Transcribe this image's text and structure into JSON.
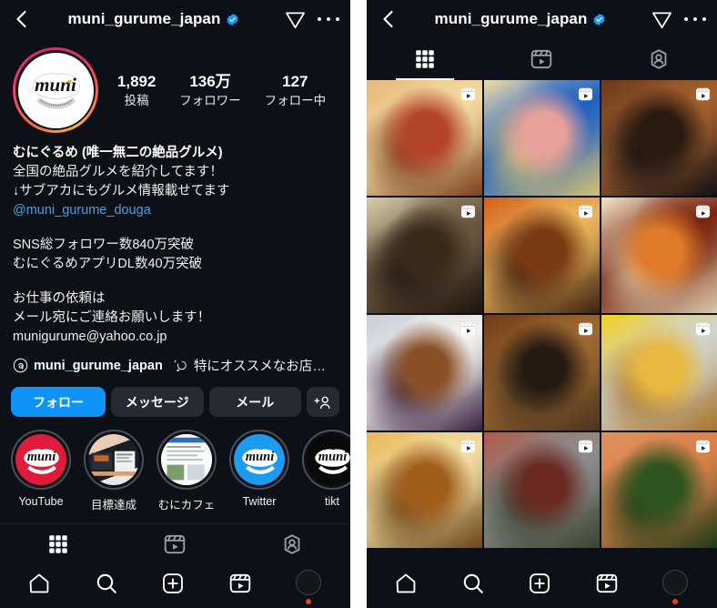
{
  "app": "Instagram",
  "header": {
    "back_icon": "back-chevron-icon",
    "username": "muni_gurume_japan",
    "verified_icon": "verified-badge-icon",
    "share_icon": "share-paperplane-icon",
    "more_icon": "more-options-icon"
  },
  "profile": {
    "avatar_icon": "profile-avatar",
    "avatar_logo_text": "muni",
    "avatar_logo_sub": "munigurume",
    "stats": [
      {
        "value": "1,892",
        "label": "投稿"
      },
      {
        "value": "136万",
        "label": "フォロワー"
      },
      {
        "value": "127",
        "label": "フォロー中"
      }
    ]
  },
  "bio": {
    "display_name": "むにぐるめ (唯一無二の絶品グルメ)",
    "lines": [
      "全国の絶品グルメを紹介してます！",
      "↓サブアカにもグルメ情報載せてます"
    ],
    "mention": "@muni_gurume_douga",
    "lines2": [
      "SNS総フォロワー数840万突破",
      "むにぐるめアプリDL数40万突破"
    ],
    "lines3": [
      "お仕事の依頼は",
      "メール宛にご連絡お願いします！",
      "munigurume@yahoo.co.jp"
    ],
    "threads": {
      "icon": "threads-icon",
      "handle": "muni_gurume_japan",
      "quote_icon": "quote-bubble-icon",
      "snippet": "特にオススメなお店を紹…"
    }
  },
  "actions": [
    {
      "label": "フォロー",
      "style": "primary",
      "name": "follow-button"
    },
    {
      "label": "メッセージ",
      "style": "secondary",
      "name": "message-button"
    },
    {
      "label": "メール",
      "style": "secondary",
      "name": "email-button"
    },
    {
      "label": "",
      "style": "icon",
      "name": "suggest-users-button",
      "icon": "add-user-icon"
    }
  ],
  "highlights": [
    {
      "label": "YouTube",
      "cover": "red-muni-logo"
    },
    {
      "label": "目標達成",
      "cover": "screenshot-collage"
    },
    {
      "label": "むにカフェ",
      "cover": "article-screenshot"
    },
    {
      "label": "Twitter",
      "cover": "blue-muni-logo"
    },
    {
      "label": "tikt",
      "cover": "black-muni-logo"
    }
  ],
  "profile_tabs": [
    {
      "icon": "grid-icon",
      "name": "tab-posts-grid",
      "active": true
    },
    {
      "icon": "reels-icon",
      "name": "tab-reels",
      "active": false
    },
    {
      "icon": "tagged-icon",
      "name": "tab-tagged",
      "active": false
    }
  ],
  "bottom_nav": [
    {
      "icon": "home-icon",
      "name": "nav-home"
    },
    {
      "icon": "search-icon",
      "name": "nav-search"
    },
    {
      "icon": "create-plus-icon",
      "name": "nav-create"
    },
    {
      "icon": "reels-icon",
      "name": "nav-reels"
    },
    {
      "icon": "profile-avatar-icon",
      "name": "nav-profile",
      "has_badge": true
    }
  ],
  "grid": {
    "badge_icon": "reel-play-icon",
    "cells": [
      {
        "alt": "cheeseburger-stack",
        "c1": "#e8b87a",
        "c2": "#b5452a",
        "c3": "#f2d9a0",
        "c4": "#7a4020"
      },
      {
        "alt": "ramen-bowl-chashu",
        "c1": "#f0dca8",
        "c2": "#e8a09a",
        "c3": "#1f62c4",
        "c4": "#d4c070"
      },
      {
        "alt": "grilled-unagi-plate",
        "c1": "#6b3a1c",
        "c2": "#2b1a10",
        "c3": "#a4602c",
        "c4": "#141014"
      },
      {
        "alt": "chef-slicing-meat",
        "c1": "#d8cfae",
        "c2": "#3a2a1c",
        "c3": "#6e5a40",
        "c4": "#1c140e"
      },
      {
        "alt": "katsu-curry-mountain",
        "c1": "#d4601e",
        "c2": "#7a3a14",
        "c3": "#eab45a",
        "c4": "#3d2010"
      },
      {
        "alt": "omurice-egg-sausage",
        "c1": "#f2e6c8",
        "c2": "#e07a28",
        "c3": "#7a2410",
        "c4": "#d8c8a8"
      },
      {
        "alt": "dorayaki-cream-anko",
        "c1": "#c8cdd6",
        "c2": "#8a5028",
        "c3": "#f2f0ec",
        "c4": "#3a2240"
      },
      {
        "alt": "unagi-donburi-pot",
        "c1": "#6e3c18",
        "c2": "#241a12",
        "c3": "#a06830",
        "c4": "#4a3520"
      },
      {
        "alt": "lemon-bun-sandwich",
        "c1": "#f2d020",
        "c2": "#e8b840",
        "c3": "#d0d4cc",
        "c4": "#a8742c"
      },
      {
        "alt": "souffle-pancake-butter",
        "c1": "#e8b858",
        "c2": "#a05e1c",
        "c3": "#f0dca0",
        "c4": "#6a4418"
      },
      {
        "alt": "grilled-beef-yakiniku",
        "c1": "#b05a4a",
        "c2": "#6a2a22",
        "c3": "#8c8c8c",
        "c4": "#3a4430"
      },
      {
        "alt": "dango-skewers-outdoor",
        "c1": "#e09060",
        "c2": "#2e5420",
        "c3": "#d88248",
        "c4": "#1e3a16"
      }
    ]
  },
  "colors": {
    "background": "#0d1117",
    "primary_button": "#0f93f6",
    "secondary_button": "#262b31",
    "link": "#4a9fe0",
    "verified": "#1d9bf0",
    "badge_dot": "#e8401f"
  }
}
